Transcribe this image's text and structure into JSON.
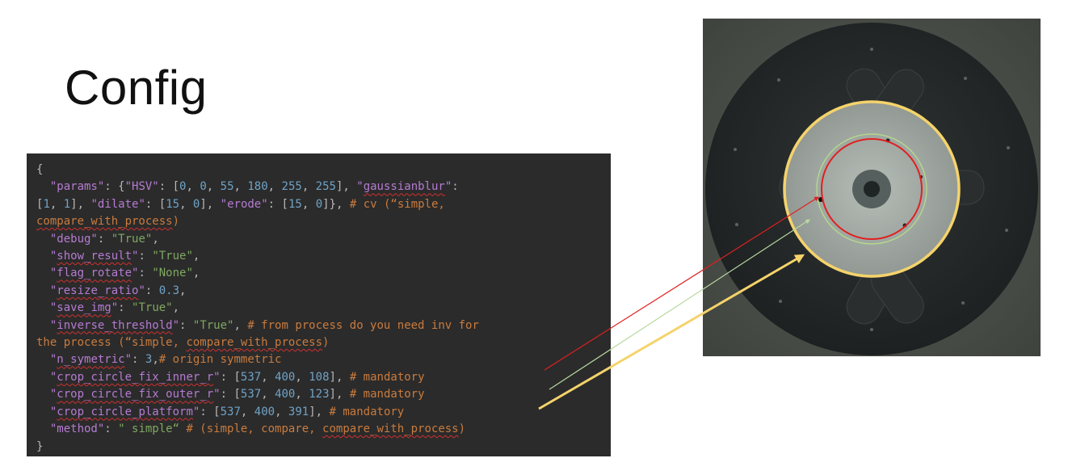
{
  "title": "Config",
  "code": {
    "lines": [
      [
        {
          "t": "{",
          "c": "p"
        }
      ],
      [
        {
          "t": "  ",
          "c": "p"
        },
        {
          "t": "\"params\"",
          "c": "k"
        },
        {
          "t": ": {",
          "c": "p"
        },
        {
          "t": "\"HSV\"",
          "c": "k"
        },
        {
          "t": ": [",
          "c": "p"
        },
        {
          "t": "0",
          "c": "n"
        },
        {
          "t": ", ",
          "c": "p"
        },
        {
          "t": "0",
          "c": "n"
        },
        {
          "t": ", ",
          "c": "p"
        },
        {
          "t": "55",
          "c": "n"
        },
        {
          "t": ", ",
          "c": "p"
        },
        {
          "t": "180",
          "c": "n"
        },
        {
          "t": ", ",
          "c": "p"
        },
        {
          "t": "255",
          "c": "n"
        },
        {
          "t": ", ",
          "c": "p"
        },
        {
          "t": "255",
          "c": "n"
        },
        {
          "t": "], ",
          "c": "p"
        },
        {
          "t": "\"",
          "c": "k"
        },
        {
          "t": "gaussianblur",
          "c": "k",
          "sq": true
        },
        {
          "t": "\"",
          "c": "k"
        },
        {
          "t": ":",
          "c": "p"
        }
      ],
      [
        {
          "t": "[",
          "c": "p"
        },
        {
          "t": "1",
          "c": "n"
        },
        {
          "t": ", ",
          "c": "p"
        },
        {
          "t": "1",
          "c": "n"
        },
        {
          "t": "], ",
          "c": "p"
        },
        {
          "t": "\"dilate\"",
          "c": "k"
        },
        {
          "t": ": [",
          "c": "p"
        },
        {
          "t": "15",
          "c": "n"
        },
        {
          "t": ", ",
          "c": "p"
        },
        {
          "t": "0",
          "c": "n"
        },
        {
          "t": "], ",
          "c": "p"
        },
        {
          "t": "\"erode\"",
          "c": "k"
        },
        {
          "t": ": [",
          "c": "p"
        },
        {
          "t": "15",
          "c": "n"
        },
        {
          "t": ", ",
          "c": "p"
        },
        {
          "t": "0",
          "c": "n"
        },
        {
          "t": "]}, ",
          "c": "p"
        },
        {
          "t": "# cv (“simple,",
          "c": "c"
        }
      ],
      [
        {
          "t": "compare_with_process",
          "c": "c",
          "sq": true
        },
        {
          "t": ")",
          "c": "c"
        }
      ],
      [
        {
          "t": "  ",
          "c": "p"
        },
        {
          "t": "\"debug\"",
          "c": "k"
        },
        {
          "t": ": ",
          "c": "p"
        },
        {
          "t": "\"True\"",
          "c": "s"
        },
        {
          "t": ",",
          "c": "p"
        }
      ],
      [
        {
          "t": "  ",
          "c": "p"
        },
        {
          "t": "\"",
          "c": "k"
        },
        {
          "t": "show_result",
          "c": "k",
          "sq": true
        },
        {
          "t": "\"",
          "c": "k"
        },
        {
          "t": ": ",
          "c": "p"
        },
        {
          "t": "\"True\"",
          "c": "s"
        },
        {
          "t": ",",
          "c": "p"
        }
      ],
      [
        {
          "t": "  ",
          "c": "p"
        },
        {
          "t": "\"",
          "c": "k"
        },
        {
          "t": "flag_rotate",
          "c": "k",
          "sq": true
        },
        {
          "t": "\"",
          "c": "k"
        },
        {
          "t": ": ",
          "c": "p"
        },
        {
          "t": "\"None\"",
          "c": "s"
        },
        {
          "t": ",",
          "c": "p"
        }
      ],
      [
        {
          "t": "  ",
          "c": "p"
        },
        {
          "t": "\"",
          "c": "k"
        },
        {
          "t": "resize_ratio",
          "c": "k",
          "sq": true
        },
        {
          "t": "\"",
          "c": "k"
        },
        {
          "t": ": ",
          "c": "p"
        },
        {
          "t": "0.3",
          "c": "n"
        },
        {
          "t": ",",
          "c": "p"
        }
      ],
      [
        {
          "t": "  ",
          "c": "p"
        },
        {
          "t": "\"",
          "c": "k"
        },
        {
          "t": "save_img",
          "c": "k",
          "sq": true
        },
        {
          "t": "\"",
          "c": "k"
        },
        {
          "t": ": ",
          "c": "p"
        },
        {
          "t": "\"True\"",
          "c": "s"
        },
        {
          "t": ",",
          "c": "p"
        }
      ],
      [
        {
          "t": "  ",
          "c": "p"
        },
        {
          "t": "\"",
          "c": "k"
        },
        {
          "t": "inverse_threshold",
          "c": "k",
          "sq": true
        },
        {
          "t": "\"",
          "c": "k"
        },
        {
          "t": ": ",
          "c": "p"
        },
        {
          "t": "\"True\"",
          "c": "s"
        },
        {
          "t": ", ",
          "c": "p"
        },
        {
          "t": "# from process do you need inv for",
          "c": "c"
        }
      ],
      [
        {
          "t": "the process (“simple, ",
          "c": "c"
        },
        {
          "t": "compare_with_process",
          "c": "c",
          "sq": true
        },
        {
          "t": ")",
          "c": "c"
        }
      ],
      [
        {
          "t": "  ",
          "c": "p"
        },
        {
          "t": "\"",
          "c": "k"
        },
        {
          "t": "n_symetric",
          "c": "k",
          "sq": true
        },
        {
          "t": "\"",
          "c": "k"
        },
        {
          "t": ": ",
          "c": "p"
        },
        {
          "t": "3",
          "c": "n"
        },
        {
          "t": ",",
          "c": "p"
        },
        {
          "t": "# origin symmetric",
          "c": "c"
        }
      ],
      [
        {
          "t": "  ",
          "c": "p"
        },
        {
          "t": "\"",
          "c": "k"
        },
        {
          "t": "crop_circle_fix_inner_r",
          "c": "k",
          "sq": true
        },
        {
          "t": "\"",
          "c": "k"
        },
        {
          "t": ": [",
          "c": "p"
        },
        {
          "t": "537",
          "c": "n"
        },
        {
          "t": ", ",
          "c": "p"
        },
        {
          "t": "400",
          "c": "n"
        },
        {
          "t": ", ",
          "c": "p"
        },
        {
          "t": "108",
          "c": "n"
        },
        {
          "t": "], ",
          "c": "p"
        },
        {
          "t": "# mandatory",
          "c": "c"
        }
      ],
      [
        {
          "t": "  ",
          "c": "p"
        },
        {
          "t": "\"",
          "c": "k"
        },
        {
          "t": "crop_circle_fix_outer_r",
          "c": "k",
          "sq": true
        },
        {
          "t": "\"",
          "c": "k"
        },
        {
          "t": ": [",
          "c": "p"
        },
        {
          "t": "537",
          "c": "n"
        },
        {
          "t": ", ",
          "c": "p"
        },
        {
          "t": "400",
          "c": "n"
        },
        {
          "t": ", ",
          "c": "p"
        },
        {
          "t": "123",
          "c": "n"
        },
        {
          "t": "], ",
          "c": "p"
        },
        {
          "t": "# mandatory",
          "c": "c"
        }
      ],
      [
        {
          "t": "  ",
          "c": "p"
        },
        {
          "t": "\"",
          "c": "k"
        },
        {
          "t": "crop_circle_platform",
          "c": "k",
          "sq": true
        },
        {
          "t": "\"",
          "c": "k"
        },
        {
          "t": ": [",
          "c": "p"
        },
        {
          "t": "537",
          "c": "n"
        },
        {
          "t": ", ",
          "c": "p"
        },
        {
          "t": "400",
          "c": "n"
        },
        {
          "t": ", ",
          "c": "p"
        },
        {
          "t": "391",
          "c": "n"
        },
        {
          "t": "], ",
          "c": "p"
        },
        {
          "t": "# mandatory",
          "c": "c"
        }
      ],
      [
        {
          "t": "  ",
          "c": "p"
        },
        {
          "t": "\"method\"",
          "c": "k"
        },
        {
          "t": ": ",
          "c": "p"
        },
        {
          "t": "\" simple“",
          "c": "s"
        },
        {
          "t": " # (simple, compare, ",
          "c": "c"
        },
        {
          "t": "compare_with_process",
          "c": "c",
          "sq": true
        },
        {
          "t": ")",
          "c": "c"
        }
      ],
      [
        {
          "t": "}",
          "c": "p"
        }
      ]
    ]
  },
  "colors": {
    "code_bg": "#2b2b2b",
    "arrow_inner": "#e02020",
    "arrow_outer": "#b8d9a0",
    "arrow_platform": "#f5d36b"
  },
  "photo": {
    "description_icon": "turntable-photo"
  }
}
